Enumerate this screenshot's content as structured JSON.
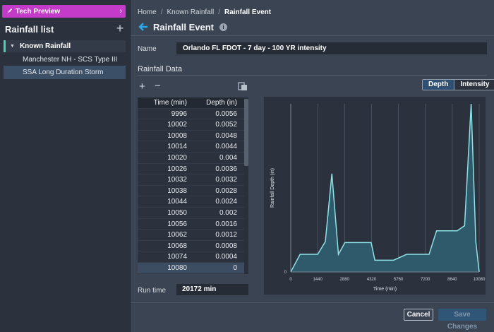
{
  "sidebar": {
    "tech_preview": "Tech Preview",
    "title": "Rainfall list",
    "group": "Known Rainfall",
    "items": [
      {
        "label": "Manchester NH - SCS Type III"
      },
      {
        "label": "SSA Long Duration Storm"
      }
    ]
  },
  "breadcrumb": [
    "Home",
    "Known Rainfall",
    "Rainfall Event"
  ],
  "page": {
    "title": "Rainfall Event",
    "name_label": "Name",
    "name_value": "Orlando FL FDOT - 7 day - 100 YR intensity",
    "section_title": "Rainfall Data",
    "run_time_label": "Run time",
    "run_time_value": "20172 min"
  },
  "toggle": {
    "depth": "Depth",
    "intensity": "Intensity",
    "active": "Depth"
  },
  "table": {
    "headers": [
      "Time (min)",
      "Depth (in)"
    ],
    "rows": [
      [
        "9996",
        "0.0056"
      ],
      [
        "10002",
        "0.0052"
      ],
      [
        "10008",
        "0.0048"
      ],
      [
        "10014",
        "0.0044"
      ],
      [
        "10020",
        "0.004"
      ],
      [
        "10026",
        "0.0036"
      ],
      [
        "10032",
        "0.0032"
      ],
      [
        "10038",
        "0.0028"
      ],
      [
        "10044",
        "0.0024"
      ],
      [
        "10050",
        "0.002"
      ],
      [
        "10056",
        "0.0016"
      ],
      [
        "10062",
        "0.0012"
      ],
      [
        "10068",
        "0.0008"
      ],
      [
        "10074",
        "0.0004"
      ],
      [
        "10080",
        "0"
      ]
    ]
  },
  "footer": {
    "cancel": "Cancel",
    "save": "Save Changes"
  },
  "colors": {
    "accent": "#2ea6e6",
    "area_fill": "#2f5a6b",
    "area_stroke": "#8ee3e6",
    "tech_preview": "#c43ac9"
  },
  "chart_data": {
    "type": "area",
    "xlabel": "Time (min)",
    "ylabel": "Rainfall Depth (in)",
    "x_ticks": [
      0,
      1440,
      2880,
      4320,
      5760,
      7200,
      8640,
      10080
    ],
    "y_ticks_shown": [
      "0"
    ],
    "xlim": [
      0,
      10080
    ],
    "ylim": [
      0,
      1
    ],
    "grid": "vertical",
    "x": [
      0,
      500,
      1440,
      1850,
      2200,
      2550,
      2900,
      3400,
      4300,
      4500,
      5500,
      6200,
      6500,
      7400,
      7800,
      8900,
      9300,
      9650,
      9900,
      10080
    ],
    "y": [
      0,
      0.105,
      0.105,
      0.18,
      0.585,
      0.105,
      0.175,
      0.175,
      0.175,
      0.07,
      0.07,
      0.105,
      0.105,
      0.105,
      0.245,
      0.245,
      0.275,
      1.0,
      0.18,
      0.0
    ]
  }
}
